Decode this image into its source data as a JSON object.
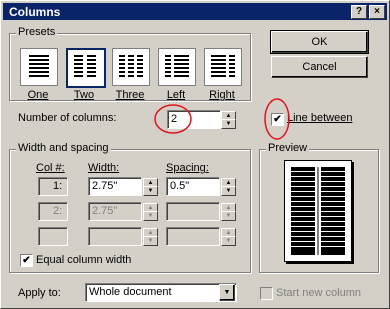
{
  "window": {
    "title": "Columns",
    "help": "?",
    "close": "×"
  },
  "presets": {
    "label": "Presets",
    "items": [
      {
        "label": "One"
      },
      {
        "label": "Two"
      },
      {
        "label": "Three"
      },
      {
        "label": "Left"
      },
      {
        "label": "Right"
      }
    ],
    "selected": "Two"
  },
  "buttons": {
    "ok": "OK",
    "cancel": "Cancel"
  },
  "number_of_columns": {
    "label": "Number of columns:",
    "value": "2"
  },
  "line_between": {
    "label": "Line between",
    "checked": true
  },
  "width_spacing": {
    "label": "Width and spacing",
    "col_header": "Col #:",
    "width_header": "Width:",
    "spacing_header": "Spacing:",
    "rows": [
      {
        "col": "1:",
        "width": "2.75\"",
        "spacing": "0.5\""
      },
      {
        "col": "2:",
        "width": "2.75\"",
        "spacing": ""
      },
      {
        "col": "",
        "width": "",
        "spacing": ""
      }
    ]
  },
  "equal_column_width": {
    "label": "Equal column width",
    "checked": true
  },
  "preview": {
    "label": "Preview"
  },
  "apply_to": {
    "label": "Apply to:",
    "value": "Whole document"
  },
  "start_new_column": {
    "label": "Start new column",
    "checked": false
  },
  "colors": {
    "title_bar": "#0a246a",
    "annotation": "#e0141e",
    "dialog_bg": "#d4d0c8"
  }
}
